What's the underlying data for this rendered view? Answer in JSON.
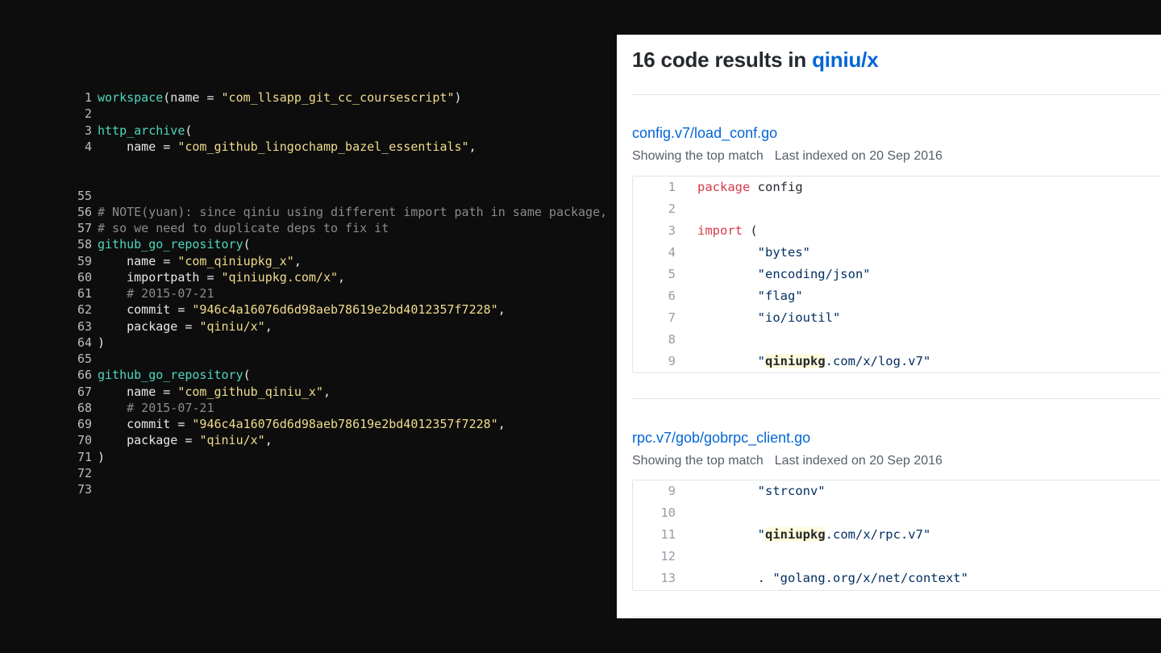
{
  "editor": {
    "lines": [
      {
        "num": "1",
        "tokens": [
          {
            "t": "workspace",
            "c": "fn"
          },
          {
            "t": "(name = ",
            "c": "plain"
          },
          {
            "t": "\"com_llsapp_git_cc_coursescript\"",
            "c": "str"
          },
          {
            "t": ")",
            "c": "plain"
          }
        ]
      },
      {
        "num": "2",
        "tokens": []
      },
      {
        "num": "3",
        "tokens": [
          {
            "t": "http_archive",
            "c": "fn"
          },
          {
            "t": "(",
            "c": "plain"
          }
        ]
      },
      {
        "num": "4",
        "tokens": [
          {
            "t": "    name = ",
            "c": "plain"
          },
          {
            "t": "\"com_github_lingochamp_bazel_essentials\"",
            "c": "str"
          },
          {
            "t": ",",
            "c": "plain"
          }
        ]
      },
      {
        "num": "55",
        "tokens": []
      },
      {
        "num": "56",
        "tokens": [
          {
            "t": "# NOTE(yuan): since qiniu using different import path in same package,",
            "c": "com"
          }
        ]
      },
      {
        "num": "57",
        "tokens": [
          {
            "t": "# so we need to duplicate deps to fix it",
            "c": "com"
          }
        ]
      },
      {
        "num": "58",
        "tokens": [
          {
            "t": "github_go_repository",
            "c": "fn"
          },
          {
            "t": "(",
            "c": "plain"
          }
        ]
      },
      {
        "num": "59",
        "tokens": [
          {
            "t": "    name = ",
            "c": "plain"
          },
          {
            "t": "\"com_qiniupkg_x\"",
            "c": "str"
          },
          {
            "t": ",",
            "c": "plain"
          }
        ]
      },
      {
        "num": "60",
        "tokens": [
          {
            "t": "    importpath = ",
            "c": "plain"
          },
          {
            "t": "\"qiniupkg.com/x\"",
            "c": "str"
          },
          {
            "t": ",",
            "c": "plain"
          }
        ]
      },
      {
        "num": "61",
        "tokens": [
          {
            "t": "    # 2015-07-21",
            "c": "com"
          }
        ]
      },
      {
        "num": "62",
        "tokens": [
          {
            "t": "    commit = ",
            "c": "plain"
          },
          {
            "t": "\"946c4a16076d6d98aeb78619e2bd4012357f7228\"",
            "c": "str"
          },
          {
            "t": ",",
            "c": "plain"
          }
        ]
      },
      {
        "num": "63",
        "tokens": [
          {
            "t": "    package = ",
            "c": "plain"
          },
          {
            "t": "\"qiniu/x\"",
            "c": "str"
          },
          {
            "t": ",",
            "c": "plain"
          }
        ]
      },
      {
        "num": "64",
        "tokens": [
          {
            "t": ")",
            "c": "plain"
          }
        ]
      },
      {
        "num": "65",
        "tokens": []
      },
      {
        "num": "66",
        "tokens": [
          {
            "t": "github_go_repository",
            "c": "fn"
          },
          {
            "t": "(",
            "c": "plain"
          }
        ]
      },
      {
        "num": "67",
        "tokens": [
          {
            "t": "    name = ",
            "c": "plain"
          },
          {
            "t": "\"com_github_qiniu_x\"",
            "c": "str"
          },
          {
            "t": ",",
            "c": "plain"
          }
        ]
      },
      {
        "num": "68",
        "tokens": [
          {
            "t": "    # 2015-07-21",
            "c": "com"
          }
        ]
      },
      {
        "num": "69",
        "tokens": [
          {
            "t": "    commit = ",
            "c": "plain"
          },
          {
            "t": "\"946c4a16076d6d98aeb78619e2bd4012357f7228\"",
            "c": "str"
          },
          {
            "t": ",",
            "c": "plain"
          }
        ]
      },
      {
        "num": "70",
        "tokens": [
          {
            "t": "    package = ",
            "c": "plain"
          },
          {
            "t": "\"qiniu/x\"",
            "c": "str"
          },
          {
            "t": ",",
            "c": "plain"
          }
        ]
      },
      {
        "num": "71",
        "tokens": [
          {
            "t": ")",
            "c": "plain"
          }
        ]
      },
      {
        "num": "72",
        "tokens": []
      },
      {
        "num": "73",
        "tokens": []
      }
    ]
  },
  "search": {
    "count": "16",
    "title_middle": " code results in ",
    "repo": "qiniu/x",
    "results": [
      {
        "file": "config.v7/load_conf.go",
        "top_match": "Showing the top match",
        "indexed": "Last indexed on 20 Sep 2016",
        "lines": [
          {
            "num": "1",
            "tokens": [
              {
                "t": "package",
                "c": "kw"
              },
              {
                "t": " config",
                "c": "plain"
              }
            ]
          },
          {
            "num": "2",
            "tokens": []
          },
          {
            "num": "3",
            "tokens": [
              {
                "t": "import",
                "c": "kw"
              },
              {
                "t": " (",
                "c": "plain"
              }
            ]
          },
          {
            "num": "4",
            "tokens": [
              {
                "t": "        \"bytes\"",
                "c": "str"
              }
            ]
          },
          {
            "num": "5",
            "tokens": [
              {
                "t": "        \"encoding/json\"",
                "c": "str"
              }
            ]
          },
          {
            "num": "6",
            "tokens": [
              {
                "t": "        \"flag\"",
                "c": "str"
              }
            ]
          },
          {
            "num": "7",
            "tokens": [
              {
                "t": "        \"io/ioutil\"",
                "c": "str"
              }
            ]
          },
          {
            "num": "8",
            "tokens": []
          },
          {
            "num": "9",
            "tokens": [
              {
                "t": "        \"",
                "c": "str"
              },
              {
                "t": "qiniupkg",
                "c": "hl"
              },
              {
                "t": ".com/x/log.v7\"",
                "c": "str"
              }
            ]
          }
        ]
      },
      {
        "file": "rpc.v7/gob/gobrpc_client.go",
        "top_match": "Showing the top match",
        "indexed": "Last indexed on 20 Sep 2016",
        "lines": [
          {
            "num": "9",
            "tokens": [
              {
                "t": "        \"strconv\"",
                "c": "str"
              }
            ]
          },
          {
            "num": "10",
            "tokens": []
          },
          {
            "num": "11",
            "tokens": [
              {
                "t": "        \"",
                "c": "str"
              },
              {
                "t": "qiniupkg",
                "c": "hl"
              },
              {
                "t": ".com/x/rpc.v7\"",
                "c": "str"
              }
            ]
          },
          {
            "num": "12",
            "tokens": []
          },
          {
            "num": "13",
            "tokens": [
              {
                "t": "        . ",
                "c": "plain"
              },
              {
                "t": "\"golang.org/x/net/context\"",
                "c": "str"
              }
            ]
          }
        ]
      }
    ]
  }
}
